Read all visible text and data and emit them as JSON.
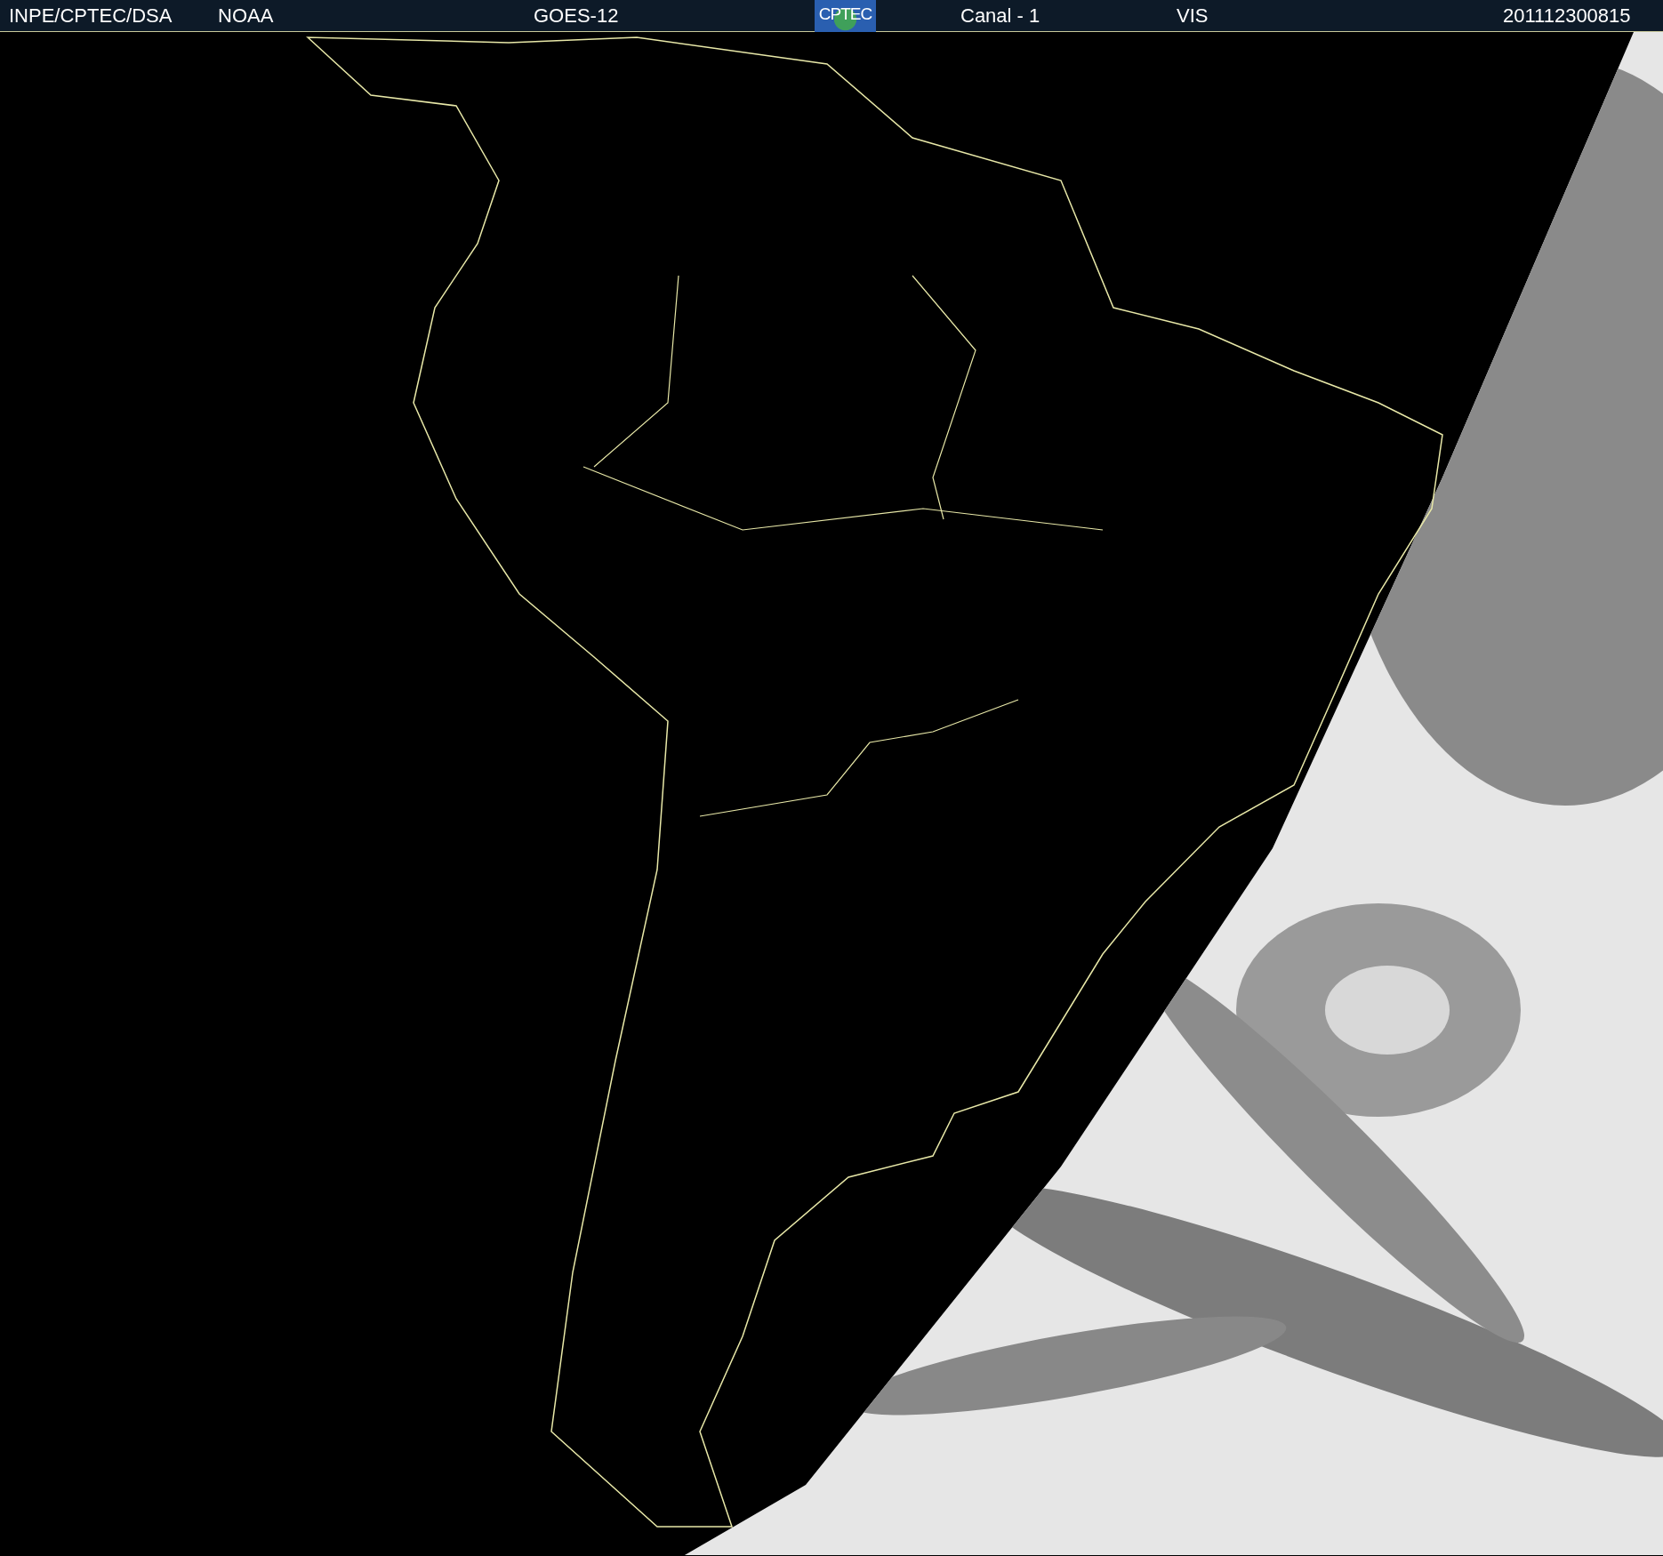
{
  "header": {
    "items": [
      {
        "kind": "text",
        "text": "INPE/CPTEC/DSA"
      },
      {
        "kind": "text",
        "text": "NOAA"
      },
      {
        "kind": "text",
        "text": "GOES-12"
      },
      {
        "kind": "logo",
        "text": "CPTEC"
      },
      {
        "kind": "text",
        "text": "Canal - 1"
      },
      {
        "kind": "text",
        "text": "VIS"
      },
      {
        "kind": "text",
        "text": "201112300815"
      }
    ]
  }
}
